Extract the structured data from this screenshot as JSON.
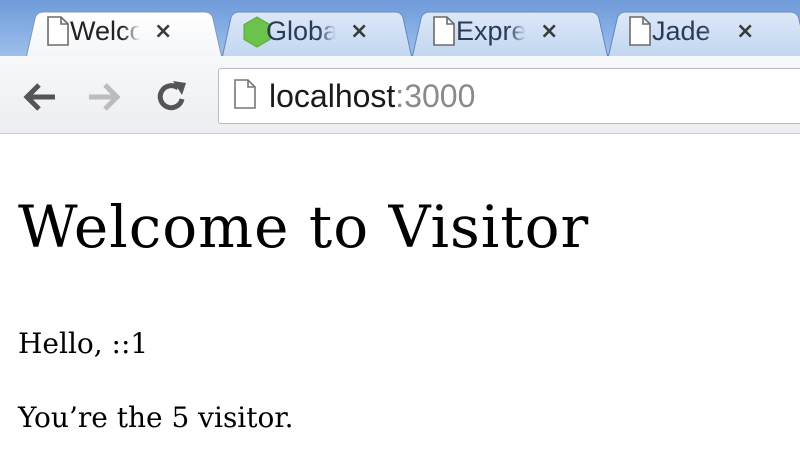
{
  "tabs": [
    {
      "title": "Welcome to Visitor",
      "icon": "document-icon",
      "active": true
    },
    {
      "title": "Global",
      "icon": "nodejs-hexagon-icon",
      "active": false
    },
    {
      "title": "Express",
      "icon": "document-icon",
      "active": false
    },
    {
      "title": "Jade",
      "icon": "document-icon",
      "active": false
    }
  ],
  "tab_close_glyph": "×",
  "address_bar": {
    "host": "localhost",
    "port": ":3000"
  },
  "page": {
    "heading": "Welcome to Visitor",
    "greeting": "Hello, ::1",
    "visitor_message": "You’re the 5 visitor."
  },
  "colors": {
    "tabstrip": "#8ab0e6",
    "nodejs_green": "#6cc24a"
  }
}
